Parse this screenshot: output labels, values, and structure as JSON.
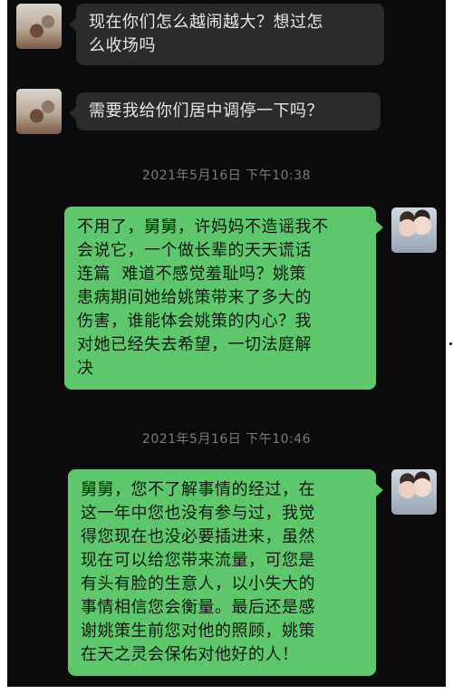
{
  "messages": [
    {
      "sender": "uncle",
      "side": "left",
      "text": "现在你们怎么越闹越大？想过怎\n么收场吗"
    },
    {
      "sender": "uncle",
      "side": "left",
      "text": "需要我给你们居中调停一下吗？"
    },
    {
      "type": "timestamp",
      "text": "2021年5月16日 下午10:38"
    },
    {
      "sender": "me",
      "side": "right",
      "text": "不用了，舅舅，许妈妈不造谣我不\n会说它，一个做长辈的天天谎话\n连篇  难道不感觉羞耻吗？姚策\n患病期间她给姚策带来了多大的\n伤害，谁能体会姚策的内心？我\n对她已经失去希望，一切法庭解\n决"
    },
    {
      "type": "timestamp",
      "text": "2021年5月16日 下午10:46"
    },
    {
      "sender": "me",
      "side": "right",
      "text": "舅舅，您不了解事情的经过，在\n这一年中您也没有参与过，我觉\n得您现在也没必要插进来，虽然\n现在可以给您带来流量，可您是\n有头有脸的生意人，以小失大的\n事情相信您会衡量。最后还是感\n谢姚策生前您对他的照顾，姚策\n在天之灵会保佑对他好的人！"
    }
  ],
  "colors": {
    "background": "#0b0b0b",
    "incoming_bubble": "#2b2b2b",
    "outgoing_bubble": "#5fc76b",
    "timestamp_text": "#7a7a7a"
  },
  "icons": {
    "left_avatar": "avatar-image",
    "right_avatar": "avatar-image"
  }
}
